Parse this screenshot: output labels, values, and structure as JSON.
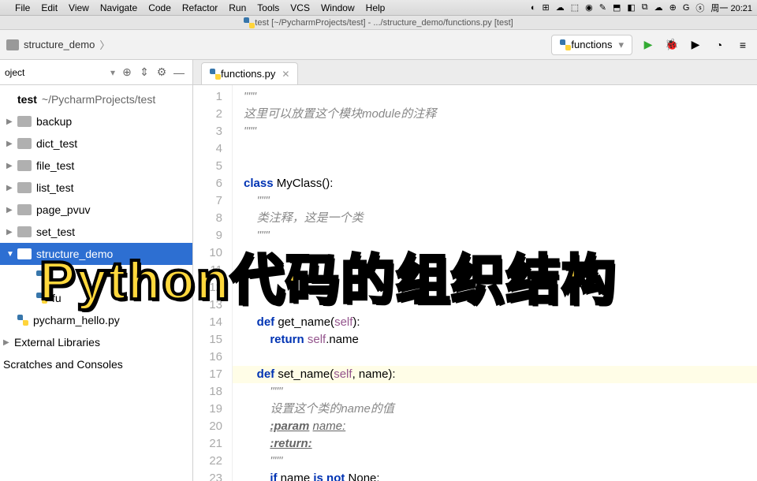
{
  "menubar": {
    "items": [
      "File",
      "Edit",
      "View",
      "Navigate",
      "Code",
      "Refactor",
      "Run",
      "Tools",
      "VCS",
      "Window",
      "Help"
    ],
    "tray_time": "周一 20:21"
  },
  "titlebar": {
    "text": "test [~/PycharmProjects/test] - .../structure_demo/functions.py [test]"
  },
  "breadcrumb": {
    "item": "structure_demo"
  },
  "runconfig": {
    "name": "functions"
  },
  "sidebar": {
    "header": "oject",
    "root_name": "test",
    "root_path": "~/PycharmProjects/test",
    "items": [
      {
        "name": "backup",
        "type": "folder",
        "level": 1
      },
      {
        "name": "dict_test",
        "type": "folder",
        "level": 1
      },
      {
        "name": "file_test",
        "type": "folder",
        "level": 1
      },
      {
        "name": "list_test",
        "type": "folder",
        "level": 1
      },
      {
        "name": "page_pvuv",
        "type": "folder",
        "level": 1
      },
      {
        "name": "set_test",
        "type": "folder",
        "level": 1
      },
      {
        "name": "structure_demo",
        "type": "folder",
        "level": 1,
        "selected": true,
        "expanded": true
      },
      {
        "name": "__init__.py",
        "type": "py",
        "level": 2,
        "obscured": true
      },
      {
        "name": "functions.py",
        "type": "py",
        "level": 2,
        "obscured": true
      },
      {
        "name": "pycharm_hello.py",
        "type": "py",
        "level": 1
      }
    ],
    "external": "External Libraries",
    "scratches": "Scratches and Consoles"
  },
  "tab": {
    "name": "functions.py"
  },
  "code": {
    "lines": [
      {
        "n": 1,
        "html": "<span class='str'>\"\"\"</span>"
      },
      {
        "n": 2,
        "html": "<span class='comment'>这里可以放置这个模块module的注释</span>"
      },
      {
        "n": 3,
        "html": "<span class='str'>\"\"\"</span>"
      },
      {
        "n": 4,
        "html": ""
      },
      {
        "n": 5,
        "html": ""
      },
      {
        "n": 6,
        "html": "<span class='kw'>class</span> <span class='cls'>MyClass</span>():"
      },
      {
        "n": 7,
        "html": "    <span class='str'>\"\"\"</span>"
      },
      {
        "n": 8,
        "html": "    <span class='comment'>类注释，这是一个类</span>"
      },
      {
        "n": 9,
        "html": "    <span class='str'>\"\"\"</span>"
      },
      {
        "n": 10,
        "html": ""
      },
      {
        "n": 11,
        "html": ""
      },
      {
        "n": 12,
        "html": ""
      },
      {
        "n": 13,
        "html": ""
      },
      {
        "n": 14,
        "html": "    <span class='kw'>def</span> get_name(<span class='self'>self</span>):"
      },
      {
        "n": 15,
        "html": "        <span class='kw'>return</span> <span class='self'>self</span>.name"
      },
      {
        "n": 16,
        "html": ""
      },
      {
        "n": 17,
        "html": "    <span class='kw'>def</span> set_name(<span class='self'>self</span>, name):",
        "hl": true
      },
      {
        "n": 18,
        "html": "        <span class='str'>\"\"\"</span>"
      },
      {
        "n": 19,
        "html": "        <span class='comment'>设置这个类的name的值</span>"
      },
      {
        "n": 20,
        "html": "        <span class='doctag'>:param</span> <span class='param'>name:</span>"
      },
      {
        "n": 21,
        "html": "        <span class='doctag'>:return:</span>"
      },
      {
        "n": 22,
        "html": "        <span class='str'>\"\"\"</span>"
      },
      {
        "n": 23,
        "html": "        <span class='kw'>if</span> name <span class='kw'>is not</span> None:"
      }
    ]
  },
  "overlay": {
    "title": "Python代码的组织结构"
  }
}
